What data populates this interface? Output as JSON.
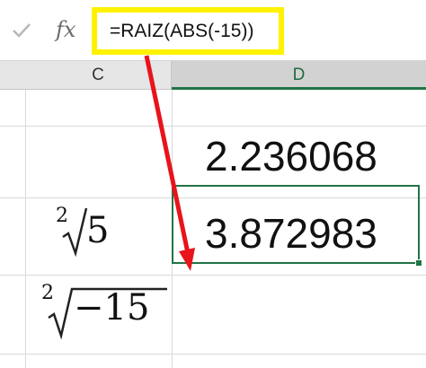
{
  "formula_bar": {
    "confirm_icon": "check-icon",
    "function_icon": "fx-icon",
    "fx_label": "fx",
    "formula": "=RAIZ(ABS(-15))",
    "highlight_color": "#fff200"
  },
  "columns": {
    "c": "C",
    "d": "D"
  },
  "cells": {
    "c_row1_math": {
      "index": "2",
      "radicand": "5"
    },
    "c_row2_math": {
      "index": "2",
      "radicand": "−15"
    },
    "d_row1": "2.236068",
    "d_row2": "3.872983"
  },
  "selection": {
    "column": "D",
    "accent_color": "#217346"
  },
  "annotation": {
    "arrow_color": "#e8141b",
    "arrow_icon": "arrow-icon"
  }
}
